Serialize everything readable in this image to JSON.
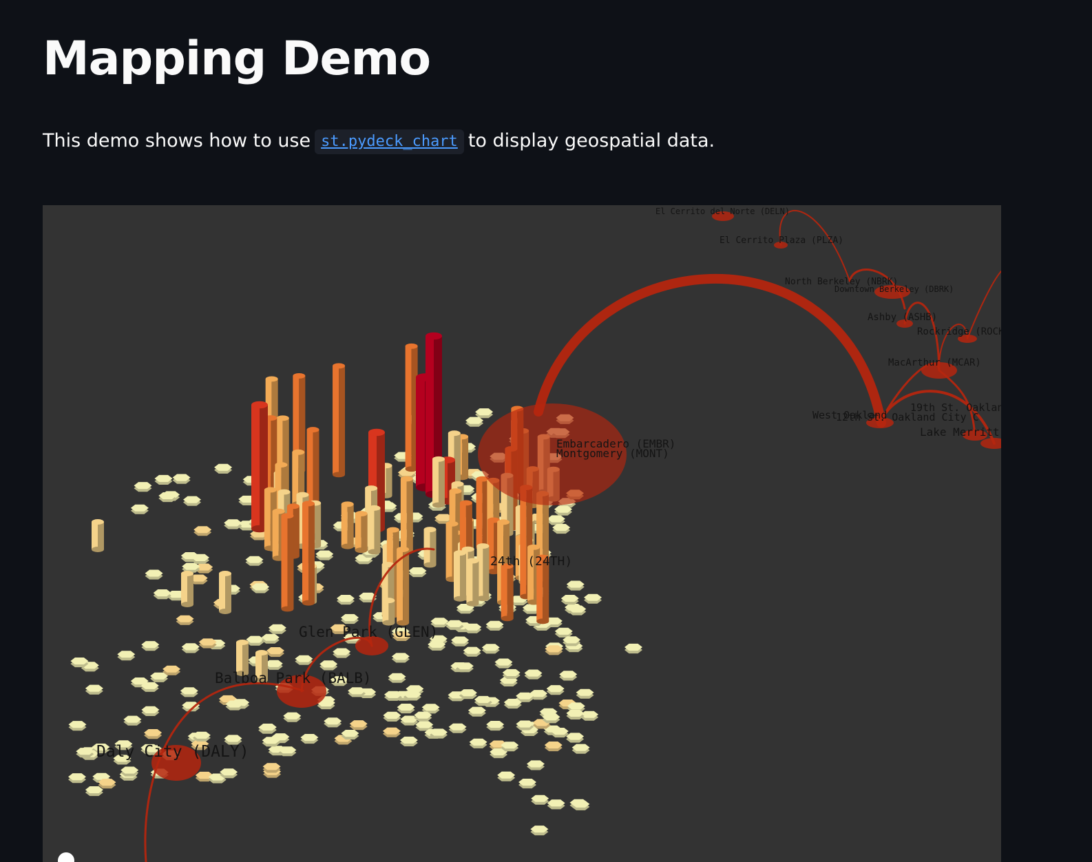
{
  "page": {
    "title": "Mapping Demo",
    "intro_before": "This demo shows how to use",
    "intro_link": "st.pydeck_chart",
    "intro_after": "to display geospatial data."
  },
  "map": {
    "background_color": "#333333",
    "hexagon_colors": [
      "#f2f0b4",
      "#f5d38a",
      "#f2aa55",
      "#e8742e",
      "#d8351e",
      "#b5001f"
    ],
    "arc_color": "#b5260f",
    "station_labels": [
      "El Cerrito del Norte (DELN)",
      "El Cerrito Plaza (PLZA)",
      "North Berkeley (NBRK)",
      "Downtown Berkeley (DBRK)",
      "Ashby (ASHB)",
      "Rockridge (ROCK)",
      "MacArthur (MCAR)",
      "19th St. Oakland",
      "West Oakland",
      "12th St. Oakland City C",
      "Lake Merritt",
      "Embarcadero (EMBR)",
      "Montgomery (MONT)",
      "24th (24TH)",
      "Glen Park (GLEN)",
      "Balboa Park (BALB)",
      "Daly City (DALY)"
    ]
  }
}
